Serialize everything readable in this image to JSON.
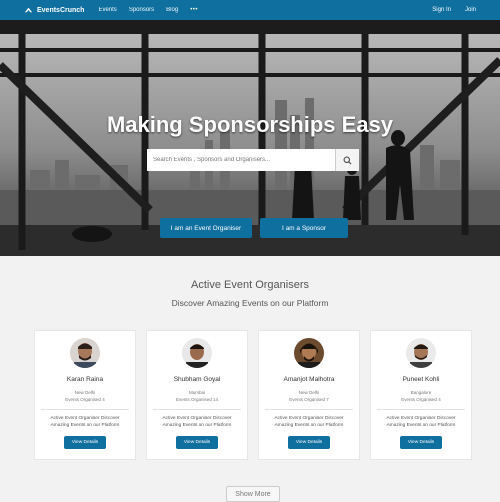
{
  "navbar": {
    "brand": "EventsCrunch",
    "links": [
      "Events",
      "Sponsors",
      "Blog"
    ],
    "more": "•••",
    "sign_in": "Sign In",
    "join": "Join",
    "brand_color": "#0f6f9f"
  },
  "hero": {
    "title": "Making Sponsorships Easy",
    "search_placeholder": "Search Events , Sponsors and Organisers...",
    "search_icon": "search-icon",
    "organiser_button": "I am an Event Organiser",
    "sponsor_button": "I am a Sponsor"
  },
  "section": {
    "title": "Active Event Organisers",
    "subtitle": "Discover Amazing Events on our Platform"
  },
  "cards": [
    {
      "name": "Karan Raina",
      "city": "New Delhi",
      "count": "Events Organised 4",
      "desc": "Active Event Organiser Discover Amazing Events on our Platform",
      "button": "View Details"
    },
    {
      "name": "Shubham Goyal",
      "city": "Mumbai",
      "count": "Events Organised 14",
      "desc": "Active Event Organiser Discover Amazing Events on our Platform",
      "button": "View Details"
    },
    {
      "name": "Amanjot Malhotra",
      "city": "New Delhi",
      "count": "Events Organised 7",
      "desc": "Active Event Organiser Discover Amazing Events on our Platform",
      "button": "View Details"
    },
    {
      "name": "Puneet Kohli",
      "city": "Bangalore",
      "count": "Events Organised 4",
      "desc": "Active Event Organiser Discover Amazing Events on our Platform",
      "button": "View Details"
    }
  ],
  "show_more": "Show More"
}
